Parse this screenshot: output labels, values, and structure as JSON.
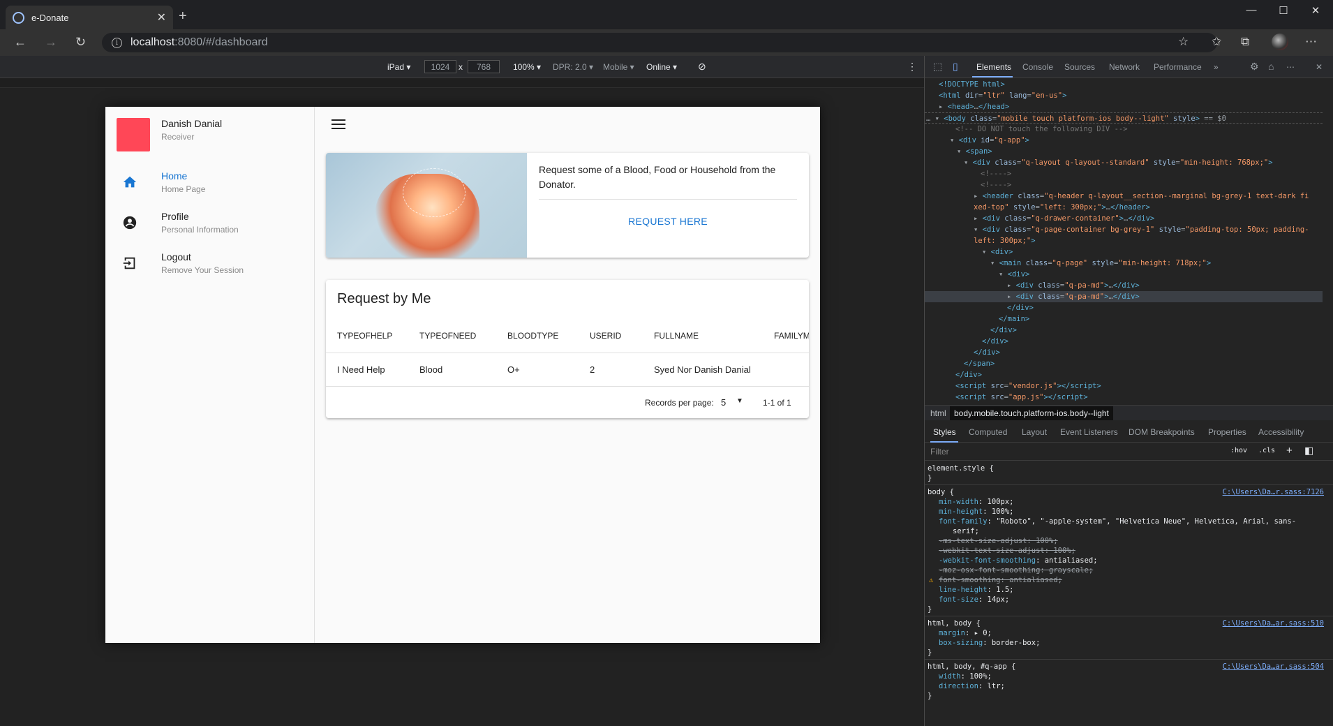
{
  "browser": {
    "tab_title": "e-Donate",
    "url_host": "localhost",
    "url_path": ":8080/#/dashboard"
  },
  "device_toolbar": {
    "device": "iPad ▾",
    "width": "1024",
    "x": "x",
    "height": "768",
    "zoom": "100% ▾",
    "dpr": "DPR: 2.0 ▾",
    "mode": "Mobile ▾",
    "network": "Online ▾"
  },
  "app": {
    "user_name": "Danish Danial",
    "user_role": "Receiver",
    "menu": [
      {
        "label": "Home",
        "sub": "Home Page"
      },
      {
        "label": "Profile",
        "sub": "Personal Information"
      },
      {
        "label": "Logout",
        "sub": "Remove Your Session"
      }
    ],
    "card_text": "Request some of a Blood, Food or Household from the Donator.",
    "card_button": "REQUEST HERE",
    "table_title": "Request by Me",
    "columns": [
      "TYPEOFHELP",
      "TYPEOFNEED",
      "BLOODTYPE",
      "USERID",
      "FULLNAME",
      "FAMILYMEMBER"
    ],
    "rows": [
      [
        "I Need Help",
        "Blood",
        "O+",
        "2",
        "Syed Nor Danish Danial",
        ""
      ]
    ],
    "records_label": "Records per page:",
    "records_value": "5",
    "pagination": "1-1 of 1"
  },
  "devtools": {
    "tabs": [
      "Elements",
      "Console",
      "Sources",
      "Network",
      "Performance"
    ],
    "crumb_html": "html",
    "crumb_body": "body.mobile.touch.platform-ios.body--light",
    "subtabs": [
      "Styles",
      "Computed",
      "Layout",
      "Event Listeners",
      "DOM Breakpoints",
      "Properties",
      "Accessibility"
    ],
    "filter_placeholder": "Filter",
    "hov": ":hov",
    "cls": ".cls",
    "src1": "C:\\Users\\Da…r.sass:7126",
    "src2": "C:\\Users\\Da…ar.sass:510",
    "src3": "C:\\Users\\Da…ar.sass:504"
  }
}
